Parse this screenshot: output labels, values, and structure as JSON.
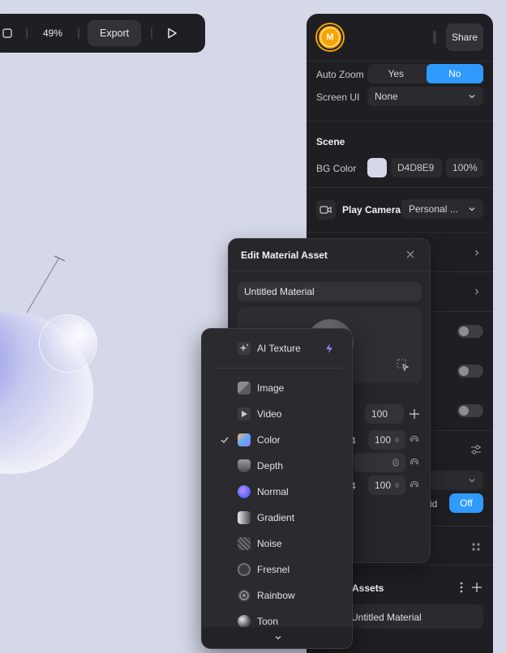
{
  "toolbar": {
    "zoom": "49%",
    "export_label": "Export"
  },
  "panel": {
    "avatar_initial": "M",
    "share_label": "Share",
    "auto_zoom_label": "Auto Zoom",
    "auto_zoom_options": [
      "Yes",
      "No"
    ],
    "auto_zoom_selected": "No",
    "screen_ui_label": "Screen UI",
    "screen_ui_value": "None",
    "scene_heading": "Scene",
    "bg_color_label": "BG Color",
    "bg_color_hex": "D4D8E9",
    "bg_color_opacity": "100%",
    "bg_color_swatch": "#d4d8e9",
    "play_camera_label": "Play Camera",
    "play_camera_value": "Personal ...",
    "off_label": "Off",
    "assets_label": "Assets",
    "asset_item": "Untitled Material"
  },
  "material": {
    "title": "Edit Material Asset",
    "name_value": "Untitled Material",
    "value_main": "100",
    "row1_left": "4",
    "row1_value": "100",
    "row3_left": "4",
    "row3_value": "100",
    "partial_label": "id"
  },
  "dropdown": {
    "ai_label": "AI Texture",
    "items": [
      {
        "label": "Image",
        "checked": false
      },
      {
        "label": "Video",
        "checked": false
      },
      {
        "label": "Color",
        "checked": true
      },
      {
        "label": "Depth",
        "checked": false
      },
      {
        "label": "Normal",
        "checked": false
      },
      {
        "label": "Gradient",
        "checked": false
      },
      {
        "label": "Noise",
        "checked": false
      },
      {
        "label": "Fresnel",
        "checked": false
      },
      {
        "label": "Rainbow",
        "checked": false
      },
      {
        "label": "Toon",
        "checked": false
      }
    ]
  },
  "colors": {
    "accent": "#2f9bff",
    "canvas_bg": "#d4d8e9",
    "panel_bg": "#1f1f23",
    "avatar": "#f6a400"
  }
}
